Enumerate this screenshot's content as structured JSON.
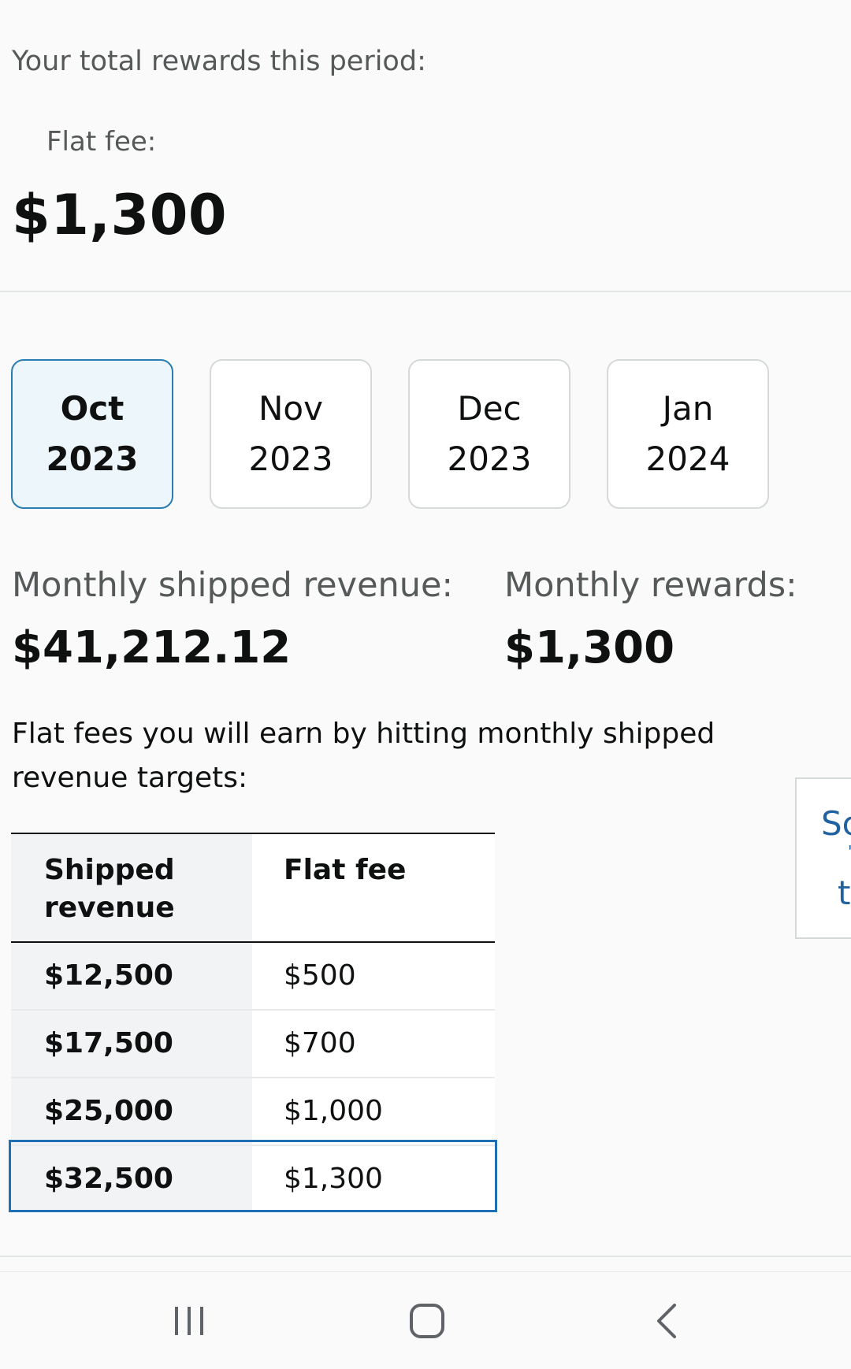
{
  "header": {
    "total_label": "Your total rewards this period:",
    "flat_fee_label": "Flat fee:",
    "total_amount": "$1,300"
  },
  "months": [
    {
      "month": "Oct",
      "year": "2023",
      "selected": true
    },
    {
      "month": "Nov",
      "year": "2023",
      "selected": false
    },
    {
      "month": "Dec",
      "year": "2023",
      "selected": false
    },
    {
      "month": "Jan",
      "year": "2024",
      "selected": false
    }
  ],
  "metrics": {
    "revenue_label": "Monthly shipped revenue:",
    "revenue_value": "$41,212.12",
    "rewards_label": "Monthly rewards:",
    "rewards_value": "$1,300"
  },
  "description": "Flat fees you will earn by hitting monthly shipped revenue targets:",
  "side_card": {
    "line1": "Sc",
    "line2": "'",
    "line3": "t"
  },
  "table": {
    "headers": [
      "Shipped revenue",
      "Flat fee"
    ],
    "rows": [
      [
        "$12,500",
        "$500"
      ],
      [
        "$17,500",
        "$700"
      ],
      [
        "$25,000",
        "$1,000"
      ],
      [
        "$32,500",
        "$1,300"
      ]
    ],
    "highlighted_row": 3
  },
  "colors": {
    "accent": "#2a7db0",
    "selected_tab_bg": "#edf6fb",
    "link": "#2162a1"
  },
  "navbar": {
    "icons": [
      "recent-apps-icon",
      "home-icon",
      "back-icon"
    ]
  }
}
